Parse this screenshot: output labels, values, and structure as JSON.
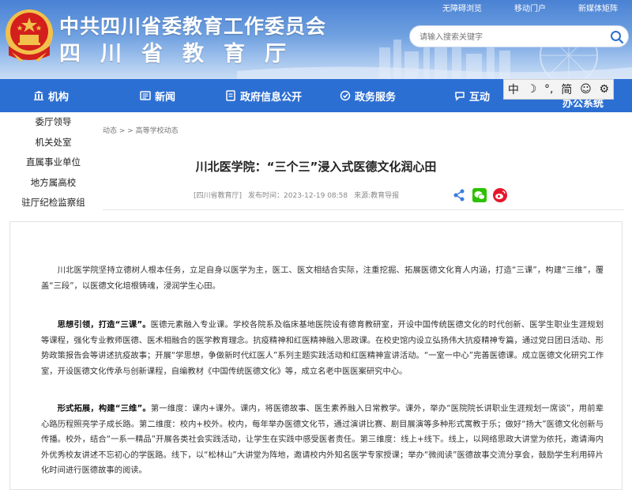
{
  "header": {
    "title_line1": "中共四川省委教育工作委员会",
    "title_line2": "四川省教育厅",
    "top_links": [
      "无障碍浏览",
      "移动门户",
      "新媒体矩阵"
    ],
    "search_placeholder": "请输入搜索关键字"
  },
  "nav": {
    "items": [
      "机构",
      "新闻",
      "政府信息公开",
      "政务服务",
      "互动",
      "办公系统"
    ]
  },
  "toolbar": {
    "lang": "中",
    "night": "☽",
    "font": "°,",
    "simp": "简",
    "face": "☺",
    "settings": "⚙"
  },
  "side_menu": [
    "委厅领导",
    "机关处室",
    "直属事业单位",
    "地方属高校",
    "驻厅纪检监察组"
  ],
  "breadcrumb": "动态 > > 高等学校动态",
  "article": {
    "title": "川北医学院：“三个三”浸入式医德文化润心田",
    "source_tag": "[四川省教育厅]",
    "published": "发布时间：2023-12-19 08:58",
    "origin": "来源:教育导报",
    "p1": "川北医学院坚持立德树人根本任务，立足自身以医学为主，医工、医文相结合实际，注重挖掘、拓展医德文化育人内涵，打造“三课”，构建“三维”，覆盖“三段”，以医德文化培根铸魂，浸润学生心田。",
    "p2_lead": "思想引领，打造“三课”。",
    "p2": "医德元素融入专业课。学校各院系及临床基地医院设有德育教研室，开设中国传统医德文化的时代创新、医学生职业生涯规划等课程，强化专业教师医德、医术相融合的医学教育理念。抗疫精神和红医精神融入思政课。在校史馆内设立弘扬伟大抗疫精神专篇，通过党日团日活动、形势政策报告会等讲述抗疫故事；开展“学思想，争做新时代红医人”系列主题实践活动和红医精神宣讲活动。“一室一中心”完善医德课。成立医德文化研究工作室，开设医德文化传承与创新课程，自编教材《中国传统医德文化》等，成立名老中医医案研究中心。",
    "p3_lead": "形式拓展，构建“三维”。",
    "p3": "第一维度：课内+课外。课内，将医德故事、医生素养融入日常教学。课外，举办“医院院长讲职业生涯规划一席谈”，用前辈心路历程照亮学子成长路。第二维度：校内+校外。校内，每年举办医德文化节，通过演讲比赛、剧目展演等多种形式寓教于乐；做好“扬大”医德文化创新与传播。校外，结合“一系一精品”开展各类社会实践活动，让学生在实践中感受医者责任。第三维度：线上+线下。线上，以网络思政大讲堂为依托，邀请海内外优秀校友讲述不忘初心的学医路。线下，以“松林山”大讲堂为阵地，邀请校内外知名医学专家授课；举办“微阅读”医德故事交流分享会，鼓励学生利用碎片化时间进行医德故事的阅读。"
  },
  "colors": {
    "nav_bg": "#2c6fd3",
    "header_top": "#4a82d4",
    "emblem_red": "#d3201c",
    "emblem_gold": "#f2c14b"
  }
}
